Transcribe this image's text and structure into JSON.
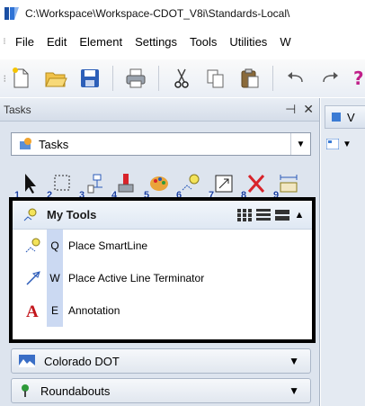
{
  "window": {
    "title": "C:\\Workspace\\Workspace-CDOT_V8i\\Standards-Local\\"
  },
  "menubar": {
    "items": [
      {
        "label": "File"
      },
      {
        "label": "Edit"
      },
      {
        "label": "Element"
      },
      {
        "label": "Settings"
      },
      {
        "label": "Tools"
      },
      {
        "label": "Utilities"
      },
      {
        "label": "W"
      }
    ]
  },
  "toolbar": {
    "icons": [
      "new-file-icon",
      "open-folder-icon",
      "save-icon",
      "print-icon",
      "cut-icon",
      "copy-icon",
      "paste-icon",
      "undo-icon",
      "redo-icon",
      "help-icon"
    ]
  },
  "tasks_panel": {
    "title": "Tasks",
    "pin_glyph": " ",
    "close_glyph": "✕",
    "dropdown_value": "Tasks",
    "task_numbers": [
      "1",
      "2",
      "3",
      "4",
      "5",
      "6",
      "7",
      "8",
      "9"
    ]
  },
  "my_tools": {
    "title": "My Tools",
    "tools": [
      {
        "key": "Q",
        "label": "Place SmartLine",
        "icon": "smartline-icon"
      },
      {
        "key": "W",
        "label": "Place Active Line Terminator",
        "icon": "line-terminator-icon"
      },
      {
        "key": "E",
        "label": "Annotation",
        "icon": "annotation-icon"
      }
    ]
  },
  "groups": [
    {
      "title": "Colorado DOT",
      "icon": "colorado-dot-icon"
    },
    {
      "title": "Roundabouts",
      "icon": "roundabouts-icon"
    }
  ],
  "right_strip": {
    "tab_label": "V"
  },
  "colors": {
    "highlight_border": "#000000",
    "key_bg": "#cbd9f2",
    "panel_bg": "#dde4ee"
  }
}
